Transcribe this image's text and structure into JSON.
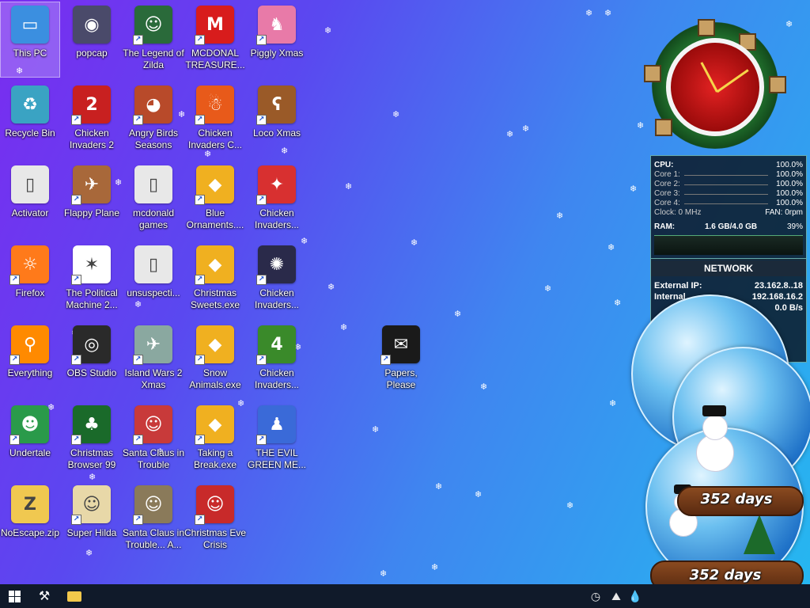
{
  "desktop": {
    "icons": [
      {
        "label": "This PC",
        "color": "#3b8fe0",
        "glyph": "▭",
        "shortcut": false
      },
      {
        "label": "popcap",
        "color": "#4a4a6a",
        "glyph": "◉",
        "shortcut": false
      },
      {
        "label": "The Legend of Zilda",
        "color": "#2a6a3a",
        "glyph": "☺",
        "shortcut": true
      },
      {
        "label": "MCDONAL TREASURE...",
        "color": "#d81c1c",
        "glyph": "M",
        "shortcut": true
      },
      {
        "label": "Piggly Xmas",
        "color": "#e87aa8",
        "glyph": "♞",
        "shortcut": true
      },
      {
        "label": "Recycle Bin",
        "color": "#3aa3c3",
        "glyph": "♻",
        "shortcut": false
      },
      {
        "label": "Chicken Invaders 2",
        "color": "#c82020",
        "glyph": "2",
        "shortcut": true
      },
      {
        "label": "Angry Birds Seasons",
        "color": "#b84a2a",
        "glyph": "◕",
        "shortcut": true
      },
      {
        "label": "Chicken Invaders C...",
        "color": "#e85a1a",
        "glyph": "☃",
        "shortcut": true
      },
      {
        "label": "Loco Xmas",
        "color": "#9a5a28",
        "glyph": "ʕ",
        "shortcut": true
      },
      {
        "label": "Activator",
        "color": "#e8e8e8",
        "glyph": "▯",
        "shortcut": false
      },
      {
        "label": "Flappy Plane",
        "color": "#a8683a",
        "glyph": "✈",
        "shortcut": true
      },
      {
        "label": "mcdonald games",
        "color": "#e8e8e8",
        "glyph": "▯",
        "shortcut": false
      },
      {
        "label": "Blue Ornaments....",
        "color": "#f0b020",
        "glyph": "◆",
        "shortcut": true
      },
      {
        "label": "Chicken Invaders...",
        "color": "#d83030",
        "glyph": "✦",
        "shortcut": true
      },
      {
        "label": "Firefox",
        "color": "#ff7a1a",
        "glyph": "☼",
        "shortcut": true
      },
      {
        "label": "The Political Machine 2...",
        "color": "#ffffff",
        "glyph": "✶",
        "shortcut": true
      },
      {
        "label": "unsuspecti...",
        "color": "#e8e8e8",
        "glyph": "▯",
        "shortcut": false
      },
      {
        "label": "Christmas Sweets.exe",
        "color": "#f0b020",
        "glyph": "◆",
        "shortcut": true
      },
      {
        "label": "Chicken Invaders...",
        "color": "#2a2a4a",
        "glyph": "✺",
        "shortcut": true
      },
      {
        "label": "Everything",
        "color": "#ff8a00",
        "glyph": "⚲",
        "shortcut": true
      },
      {
        "label": "OBS Studio",
        "color": "#2a2a2a",
        "glyph": "◎",
        "shortcut": true
      },
      {
        "label": "Island Wars 2 Xmas",
        "color": "#8aa8a0",
        "glyph": "✈",
        "shortcut": true
      },
      {
        "label": "Snow Animals.exe",
        "color": "#f0b020",
        "glyph": "◆",
        "shortcut": true
      },
      {
        "label": "Chicken Invaders...",
        "color": "#3a8a2a",
        "glyph": "4",
        "shortcut": true
      },
      {
        "label": "Undertale",
        "color": "#2a9a4a",
        "glyph": "☻",
        "shortcut": true
      },
      {
        "label": "Christmas Browser 99",
        "color": "#1a6a2a",
        "glyph": "♣",
        "shortcut": true
      },
      {
        "label": "Santa Claus in Trouble",
        "color": "#c83a3a",
        "glyph": "☺",
        "shortcut": true
      },
      {
        "label": "Taking a Break.exe",
        "color": "#f0b020",
        "glyph": "◆",
        "shortcut": true
      },
      {
        "label": "THE EVIL GREEN ME...",
        "color": "#3a6ad8",
        "glyph": "♟",
        "shortcut": true
      },
      {
        "label": "NoEscape.zip",
        "color": "#f0c850",
        "glyph": "Z",
        "shortcut": false
      },
      {
        "label": "Super Hilda",
        "color": "#e8d8a8",
        "glyph": "☺",
        "shortcut": true
      },
      {
        "label": "Santa Claus in Trouble... A...",
        "color": "#8a7a5a",
        "glyph": "☺",
        "shortcut": true
      },
      {
        "label": "Christmas Eve Crisis",
        "color": "#c82a2a",
        "glyph": "☺",
        "shortcut": true
      },
      {
        "label": "Papers, Please",
        "color": "#1a1a1a",
        "glyph": "✉",
        "shortcut": true
      }
    ],
    "selected_index": 0
  },
  "sysmon": {
    "rows": [
      {
        "label": "CPU:",
        "value": "100.0%",
        "main": true
      },
      {
        "label": "Core 1:",
        "value": "100.0%"
      },
      {
        "label": "Core 2:",
        "value": "100.0%"
      },
      {
        "label": "Core 3:",
        "value": "100.0%"
      },
      {
        "label": "Core 4:",
        "value": "100.0%"
      },
      {
        "label": "Clock: 0 MHz",
        "value": "FAN: 0rpm"
      },
      {
        "label": "RAM:",
        "mid": "1.6 GB/4.0 GB",
        "value": "39%",
        "main": true
      }
    ]
  },
  "network": {
    "title": "NETWORK",
    "rows": [
      {
        "label": "External IP:",
        "value": "23.162.8..18"
      },
      {
        "label": "Internal",
        "value": "192.168.16.2"
      },
      {
        "label": "",
        "value": "0.0 B/s"
      }
    ]
  },
  "globes": {
    "days_top": "352 days",
    "days_bottom": "352 days"
  },
  "taskbar": {
    "start": "start-icon",
    "pinned": [
      "tools-icon",
      "folder-icon"
    ],
    "tray": [
      "clock-tray-icon",
      "network-tray-icon",
      "drop-tray-icon"
    ]
  },
  "colors": {
    "taskbar": "#101a2a",
    "wallpaper_start": "#7a2cf0",
    "wallpaper_end": "#25b8f0"
  }
}
